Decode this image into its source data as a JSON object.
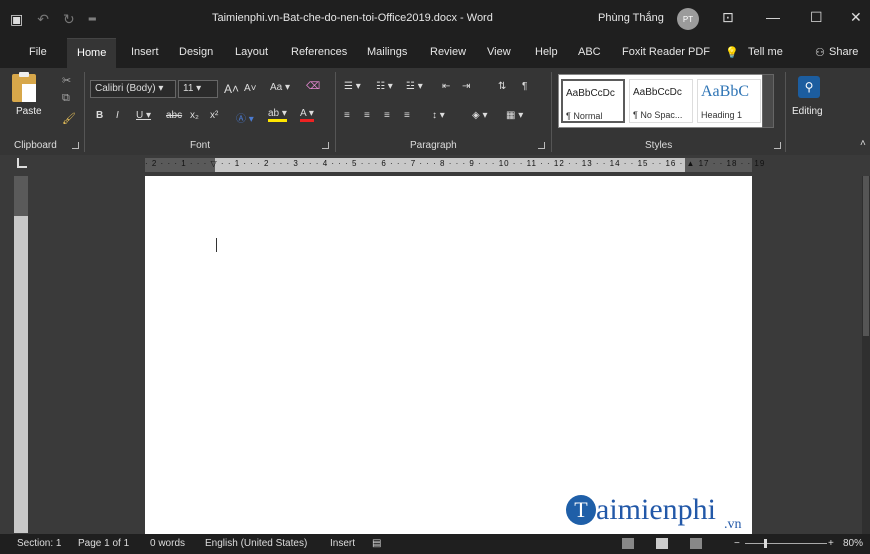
{
  "window": {
    "title": "Taimienphi.vn-Bat-che-do-nen-toi-Office2019.docx - Word",
    "user_name": "Phùng Thắng",
    "user_initials": "PT"
  },
  "tabs": [
    "File",
    "Home",
    "Insert",
    "Design",
    "Layout",
    "References",
    "Mailings",
    "Review",
    "View",
    "Help",
    "ABC",
    "Foxit Reader PDF",
    "Tell me",
    "Share"
  ],
  "active_tab": "Home",
  "ribbon": {
    "clipboard": {
      "paste_label": "Paste",
      "group_label": "Clipboard"
    },
    "font": {
      "font_name": "Calibri (Body)",
      "font_size": "11",
      "group_label": "Font",
      "case_label": "Aa"
    },
    "paragraph": {
      "group_label": "Paragraph"
    },
    "styles": {
      "group_label": "Styles",
      "items": [
        {
          "sample": "AaBbCcDc",
          "name": "¶ Normal"
        },
        {
          "sample": "AaBbCcDc",
          "name": "¶ No Spac..."
        },
        {
          "sample": "AaBbC",
          "name": "Heading 1"
        }
      ]
    },
    "editing": {
      "label": "Editing"
    }
  },
  "ruler": {
    "ticks": "· 2 · · · 1 · · · ▽ · · 1 · · · 2 · · · 3 · · · 4 · · · 5 · · · 6 · · · 7 · · · 8 · · · 9 · · · 10 · · 11 · · 12 · · 13 · · 14 · · 15 · · 16 · ▲ 17 · · 18 · · 19"
  },
  "status": {
    "section": "Section: 1",
    "page": "Page 1 of 1",
    "words": "0 words",
    "language": "English (United States)",
    "mode": "Insert",
    "zoom": "80%"
  },
  "watermark": {
    "brand": "aimienphi",
    "initial": "T",
    "suffix": ".vn"
  },
  "colors": {
    "accent": "#2b579a",
    "dark_bg": "#1f1f1f",
    "ribbon_bg": "#353535"
  }
}
